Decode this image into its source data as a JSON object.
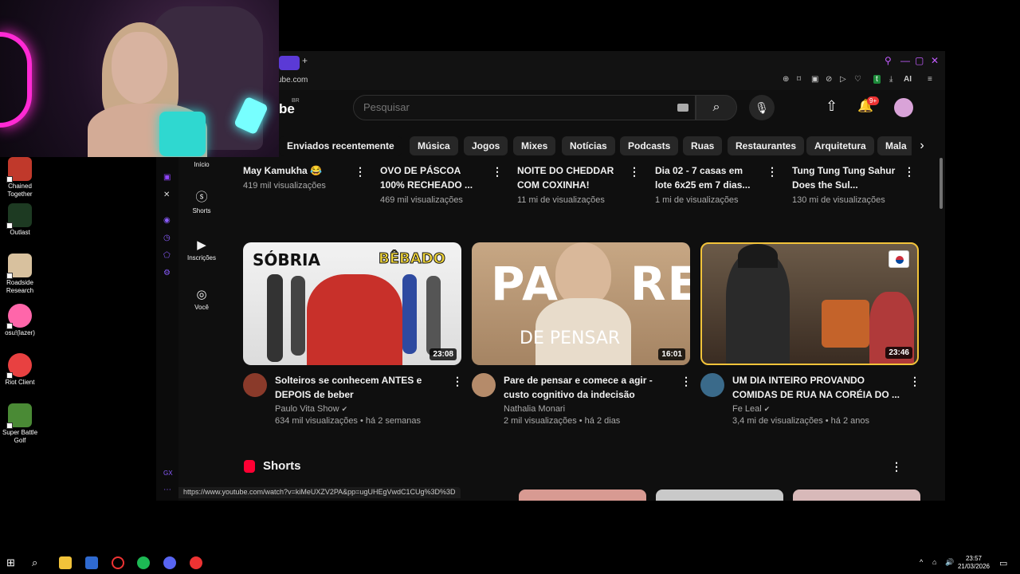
{
  "desktop_icons": [
    {
      "label": "Chained Together",
      "color": "#c0392b"
    },
    {
      "label": "Outlast",
      "color": "#1d3a22"
    },
    {
      "label": "Roadside Research",
      "color": "#d8c19e"
    },
    {
      "label": "osu!(lazer)",
      "color": "#ff66aa"
    },
    {
      "label": "Riot Client",
      "color": "#e84141"
    },
    {
      "label": "Super Battle Golf",
      "color": "#4a8a35"
    }
  ],
  "browser": {
    "new_tab": "+",
    "url": "ube.com",
    "ai_label": "AI",
    "window_controls": {
      "search": "⚲",
      "minimize": "—",
      "maximize": "▢",
      "close": "✕"
    }
  },
  "youtube": {
    "logo": "be",
    "region": "BR",
    "search_placeholder": "Pesquisar",
    "notif_count": "9+",
    "chips": [
      "Enviados recentemente",
      "Música",
      "Jogos",
      "Mixes",
      "Notícias",
      "Podcasts",
      "Ruas",
      "Restaurantes",
      "Arquitetura",
      "Mala"
    ],
    "guide": [
      {
        "label": "Início",
        "icon": "home-icon"
      },
      {
        "label": "Shorts",
        "icon": "shorts-icon"
      },
      {
        "label": "Inscrições",
        "icon": "subscriptions-icon"
      },
      {
        "label": "Você",
        "icon": "you-icon"
      }
    ],
    "top_row": [
      {
        "title": "May Kamukha 😂",
        "views": "419 mil visualizações"
      },
      {
        "title": "OVO DE PÁSCOA 100% RECHEADO ...",
        "views": "469 mil visualizações"
      },
      {
        "title": "NOITE DO CHEDDAR COM COXINHA!",
        "views": "11 mi de visualizações"
      },
      {
        "title": "Dia 02 - 7 casas em lote 6x25 em 7 dias...",
        "views": "1 mi de visualizações"
      },
      {
        "title": "Tung Tung Tung Sahur Does the Sul...",
        "views": "130 mi de visualizações"
      }
    ],
    "videos": [
      {
        "title": "Solteiros se conhecem ANTES e DEPOIS de beber",
        "channel": "Paulo Vita Show",
        "meta": "634 mil visualizações • há 2 semanas",
        "duration": "23:08",
        "thumb_text_left": "SÓBRIA",
        "thumb_text_right": "BÊBADO",
        "thumb_color": "#e9e9e9",
        "avatar_color": "#8a3a2a"
      },
      {
        "title": "Pare de pensar e comece a agir - custo cognitivo da indecisão",
        "channel": "Nathalia Monari",
        "meta": "2 mil visualizações • há 2 dias",
        "duration": "16:01",
        "thumb_text_left": "PA    RE",
        "thumb_text_right": "DE PENSAR",
        "thumb_color": "#c8a983",
        "avatar_color": "#b58b6a"
      },
      {
        "title": "UM DIA INTEIRO PROVANDO COMIDAS DE RUA NA CORÉIA DO ...",
        "channel": "Fe Leal",
        "meta": "3,4 mi de visualizações • há 2 anos",
        "duration": "23:46",
        "thumb_text_left": "",
        "thumb_text_right": "",
        "thumb_color": "#5a4a3a",
        "avatar_color": "#3a6a8a"
      }
    ],
    "shorts_title": "Shorts",
    "status_url": "https://www.youtube.com/watch?v=kiMeUXZV2PA&pp=ugUHEgVwdC1CUg%3D%3D"
  },
  "taskbar": {
    "time": "23:57",
    "date": "21/03/2026"
  }
}
